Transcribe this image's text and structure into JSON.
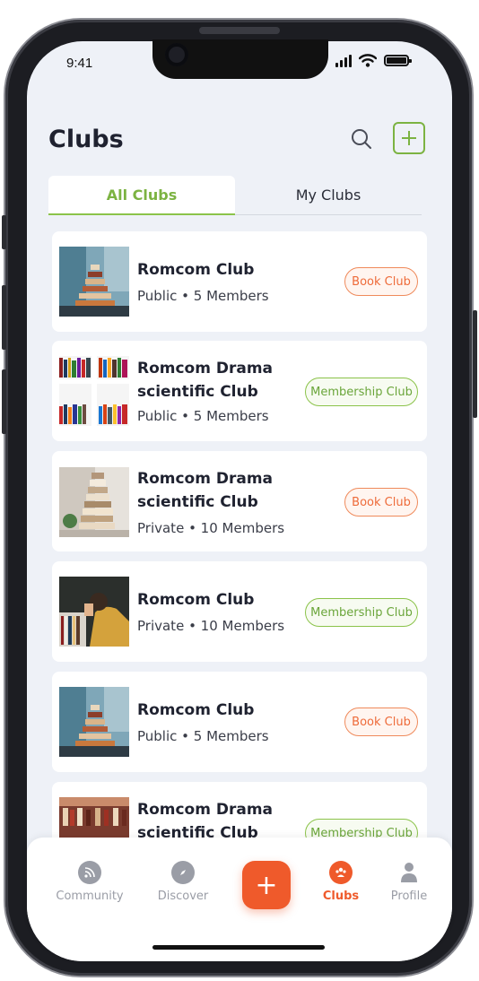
{
  "status_bar": {
    "time": "9:41"
  },
  "header": {
    "title": "Clubs"
  },
  "tabs": [
    {
      "label": "All Clubs",
      "active": true
    },
    {
      "label": "My Clubs",
      "active": false
    }
  ],
  "clubs": [
    {
      "title_line1": "Romcom Club",
      "title_line2": "",
      "meta": "Public • 5 Members",
      "badge": "Book Club",
      "badge_type": "book",
      "thumb": "book-stack-icon"
    },
    {
      "title_line1": "Romcom Drama",
      "title_line2": "scientific Club",
      "meta": "Public • 5 Members",
      "badge": "Membership Club",
      "badge_type": "member",
      "thumb": "bookshelf-icon"
    },
    {
      "title_line1": "Romcom Drama",
      "title_line2": "scientific Club",
      "meta": "Private  • 10 Members",
      "badge": "Book Club",
      "badge_type": "book",
      "thumb": "book-stack-icon"
    },
    {
      "title_line1": "Romcom Club",
      "title_line2": "",
      "meta": "Private  • 10 Members",
      "badge": "Membership Club",
      "badge_type": "member",
      "thumb": "reading-person-icon"
    },
    {
      "title_line1": "Romcom Club",
      "title_line2": "",
      "meta": "Public • 5 Members",
      "badge": "Book Club",
      "badge_type": "book",
      "thumb": "book-stack-icon"
    },
    {
      "title_line1": "Romcom Drama",
      "title_line2": "scientific Club",
      "meta": "",
      "badge": "Membership Club",
      "badge_type": "member",
      "thumb": "library-icon"
    }
  ],
  "bottom_nav": [
    {
      "label": "Community",
      "icon": "rss-icon",
      "active": false
    },
    {
      "label": "Discover",
      "icon": "compass-icon",
      "active": false
    },
    {
      "label": "+",
      "icon": "plus-icon",
      "active": false
    },
    {
      "label": "Clubs",
      "icon": "clubs-icon",
      "active": true
    },
    {
      "label": "Profile",
      "icon": "person-icon",
      "active": false
    }
  ],
  "colors": {
    "accent_green": "#8bc34a",
    "accent_orange": "#ef5a2b",
    "background": "#eef1f7"
  }
}
